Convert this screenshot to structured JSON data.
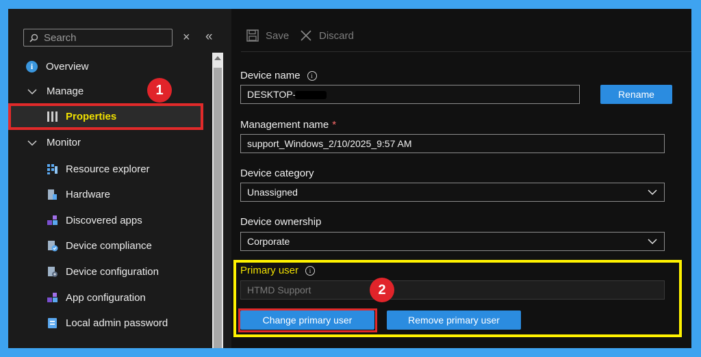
{
  "sidebar": {
    "search_placeholder": "Search",
    "close_glyph": "×",
    "collapse_glyph": "«",
    "overview": "Overview",
    "manage": "Manage",
    "properties": "Properties",
    "monitor": "Monitor",
    "items": [
      {
        "label": "Resource explorer",
        "icon": "resource-explorer-icon"
      },
      {
        "label": "Hardware",
        "icon": "hardware-icon"
      },
      {
        "label": "Discovered apps",
        "icon": "discovered-apps-icon"
      },
      {
        "label": "Device compliance",
        "icon": "device-compliance-icon"
      },
      {
        "label": "Device configuration",
        "icon": "device-configuration-icon"
      },
      {
        "label": "App configuration",
        "icon": "app-configuration-icon"
      },
      {
        "label": "Local admin password",
        "icon": "local-admin-password-icon"
      }
    ]
  },
  "toolbar": {
    "save": "Save",
    "discard": "Discard"
  },
  "form": {
    "device_name_label": "Device name",
    "device_name_value": "DESKTOP-",
    "rename_button": "Rename",
    "management_name_label": "Management name",
    "required_mark": "*",
    "management_name_value": "support_Windows_2/10/2025_9:57 AM",
    "device_category_label": "Device category",
    "device_category_value": "Unassigned",
    "device_ownership_label": "Device ownership",
    "device_ownership_value": "Corporate",
    "primary_user_label": "Primary user",
    "primary_user_value": "HTMD Support",
    "change_primary_user": "Change primary user",
    "remove_primary_user": "Remove primary user"
  },
  "annotations": {
    "badge1": "1",
    "badge2": "2"
  },
  "colors": {
    "frame": "#3ea3f0",
    "highlight_red": "#e12a2a",
    "highlight_yellow": "#fff200",
    "button_blue": "#2b8ce0",
    "active_label": "#f0e000"
  }
}
